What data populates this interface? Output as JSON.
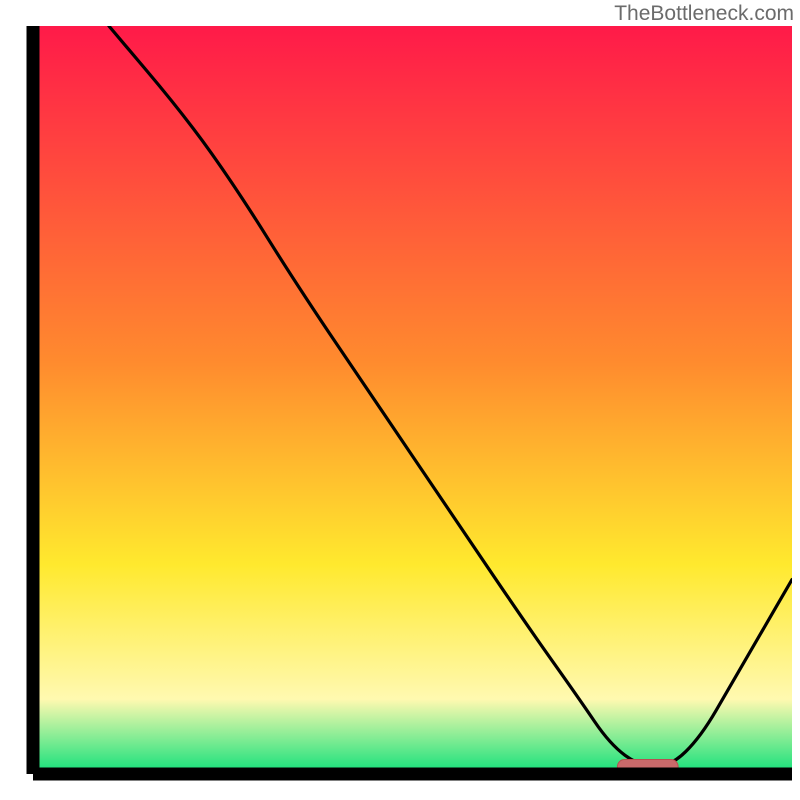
{
  "watermark": "TheBottleneck.com",
  "colors": {
    "axis": "#000000",
    "curve": "#000000",
    "marker_fill": "#c96a6b",
    "marker_stroke": "#b94f50",
    "grad_top": "#ff1a49",
    "grad_mid1": "#ff8b2e",
    "grad_mid2": "#ffe92e",
    "grad_yellowpale": "#fff9b0",
    "grad_green": "#10e07a"
  },
  "chart_data": {
    "type": "line",
    "title": "",
    "xlabel": "",
    "ylabel": "",
    "xlim": [
      0,
      100
    ],
    "ylim": [
      0,
      100
    ],
    "grid": false,
    "legend": false,
    "annotations": [
      "TheBottleneck.com"
    ],
    "x": [
      0,
      10,
      20,
      27,
      35,
      45,
      55,
      65,
      72,
      76,
      80,
      84,
      88,
      92,
      96,
      100
    ],
    "values": [
      null,
      100,
      88,
      78,
      65,
      50,
      35,
      20,
      10,
      4,
      1,
      1,
      5,
      12,
      19,
      26
    ],
    "marker": {
      "x_start": 77,
      "x_end": 85,
      "y": 1
    }
  }
}
